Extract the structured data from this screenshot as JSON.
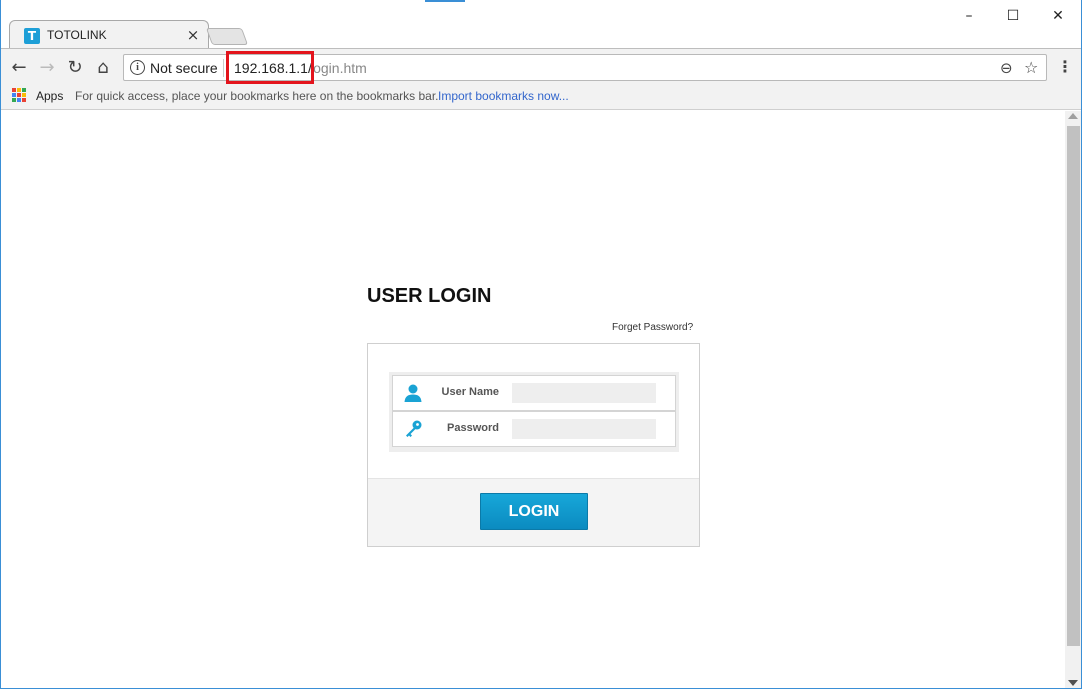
{
  "browser": {
    "tab": {
      "title": "TOTOLINK",
      "favicon_letter": "T",
      "close_glyph": "×"
    },
    "window_controls": {
      "minimize": "–",
      "maximize": "☐",
      "close": "✕"
    },
    "toolbar": {
      "security_label": "Not secure",
      "url_host": "192.168.1.1/",
      "url_path": "login.htm",
      "highlight_color": "#e3141c"
    },
    "bookmarks_bar": {
      "apps_label": "Apps",
      "hint": "For quick access, place your bookmarks here on the bookmarks bar.",
      "import_link": "Import bookmarks now..."
    }
  },
  "page": {
    "title": "USER LOGIN",
    "forget_password": "Forget Password?",
    "fields": {
      "username": {
        "label": "User Name",
        "value": ""
      },
      "password": {
        "label": "Password",
        "value": ""
      }
    },
    "login_button": "LOGIN",
    "accent_color": "#1aa3d4"
  },
  "icons": {
    "back": "back-arrow-icon",
    "forward": "forward-arrow-icon",
    "reload": "reload-icon",
    "home": "home-icon",
    "info": "info-icon",
    "zoom": "zoom-icon",
    "bookmark": "star-icon",
    "menu": "menu-icon",
    "user": "user-icon",
    "key": "key-icon"
  }
}
